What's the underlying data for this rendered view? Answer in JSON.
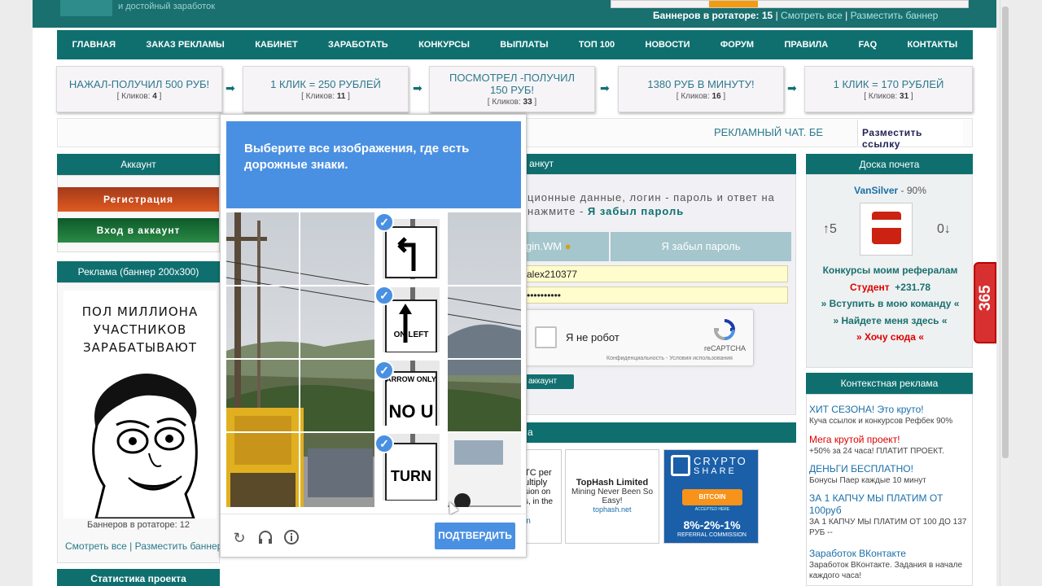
{
  "header": {
    "logo_sub": "и достойный заработок",
    "rotator_prefix": "Баннеров в ротаторе:",
    "rotator_count": "15",
    "sep1": "|",
    "view_all": "Смотреть все",
    "sep2": "|",
    "place_banner": "Разместить баннер"
  },
  "nav": [
    "ГЛАВНАЯ",
    "ЗАКАЗ РЕКЛАМЫ",
    "КАБИНЕТ",
    "ЗАРАБОТАТЬ",
    "КОНКУРСЫ",
    "ВЫПЛАТЫ",
    "ТОП 100",
    "НОВОСТИ",
    "ФОРУМ",
    "ПРАВИЛА",
    "FAQ",
    "КОНТАКТЫ"
  ],
  "promos": [
    {
      "title": "НАЖАЛ-ПОЛУЧИЛ 500 РУБ!",
      "clicks_label": "[ Кликов:",
      "clicks": "4",
      "close": "]"
    },
    {
      "title": "1 КЛИК = 250 РУБЛЕЙ",
      "clicks_label": "[ Кликов:",
      "clicks": "11",
      "close": "]"
    },
    {
      "title": "ПОСМОТРЕЛ -ПОЛУЧИЛ 150 РУБ!",
      "clicks_label": "[ Кликов:",
      "clicks": "33",
      "close": "]"
    },
    {
      "title": "1380 РУБ В МИНУТУ!",
      "clicks_label": "[ Кликов:",
      "clicks": "16",
      "close": "]"
    },
    {
      "title": "1 КЛИК = 170 РУБЛЕЙ",
      "clicks_label": "[ Кликов:",
      "clicks": "31",
      "close": "]"
    }
  ],
  "row2": {
    "chat": "РЕКЛАМНЫЙ ЧАТ. БЕ",
    "place_link": "Разместить ссылку"
  },
  "account": {
    "title": "Аккаунт",
    "register": "Регистрация",
    "login": "Вход в аккаунт"
  },
  "ad": {
    "title": "Реклама (баннер 200x300)",
    "text": [
      "ПОЛ МИЛЛИОНА",
      "УЧАСТНИКОВ",
      "ЗАРАБАТЫВАЮТ"
    ],
    "rotator": "Баннеров в ротаторе: 12",
    "view_all": "Смотреть все",
    "sep": "|",
    "place": "Разместить баннер"
  },
  "stats": {
    "title": "Статистика проекта"
  },
  "center": {
    "head": "анкут",
    "text1": "ционные данные, логин - пароль и ответ на",
    "text2_a": "нажмите -",
    "text2_b": "Я забыл пароль",
    "tab_wm": "gin.WM",
    "tab_forgot": "Я забыл пароль",
    "login_value": "alex210377",
    "password_value": "••••••••••",
    "recaptcha_label": "Я не робот",
    "recaptcha_name": "reCAPTCHA",
    "recaptcha_sub": "Конфиденциальность - Условия использования",
    "enter_btn": "аккаунт",
    "lower_head": "а"
  },
  "minibanners": {
    "left_lines": [
      "TC per",
      "ultiply",
      "sion on",
      "s, in the",
      "t",
      "in"
    ],
    "tophash_title": "TopHash Limited",
    "tophash_desc": "Mining Never Been So Easy!",
    "tophash_url": "tophash.net",
    "crypto_line1": "CRYPTO",
    "crypto_line2": "SHARE",
    "crypto_bitcoin": "BITCOIN",
    "crypto_accepted": "ACCEPTED HERE",
    "crypto_rates": "8%-2%-1%",
    "crypto_referral": "REFERRAL COMMISSION"
  },
  "honor": {
    "title": "Доска почета",
    "user": "VanSilver",
    "percent": "- 90%",
    "up": "↑5",
    "down": "0↓",
    "contests": "Конкурсы моим рефералам",
    "student": "Студент",
    "amount": "+231.78",
    "join": "» Вступить в мою команду «",
    "find": "» Найдете меня здесь «",
    "want": "» Хочу сюда «"
  },
  "context": {
    "title": "Контекстная реклама",
    "items": [
      {
        "t": "ХИТ СЕЗОНА! Это круто!",
        "d": "Куча ссылок и конкурсов Рефбек 90%",
        "red": false
      },
      {
        "t": "Мега крутой проект!",
        "d": "+50% за 24 часа! ПЛАТИТ ПРОЕКТ.",
        "red": true
      },
      {
        "t": "ДЕНЬГИ БЕСПЛАТНО!",
        "d": "Бонусы Паер каждые 10 минут",
        "red": false
      },
      {
        "t": "ЗА 1 КАПЧУ МЫ ПЛАТИМ ОТ 100руб",
        "d": "ЗА 1 КАПЧУ МЫ ПЛАТИМ ОТ 100 ДО 137 РУБ --",
        "red": false
      },
      {
        "t": "Заработок ВКонтакте",
        "d": "Заработок ВКонтакте. Задания в начале каждого часа!",
        "red": false
      }
    ]
  },
  "tab365": "365",
  "captcha": {
    "instruction": "Выберите все изображения, где есть",
    "target": "дорожные знаки.",
    "verify": "ПОДТВЕРДИТЬ",
    "sign_texts": [
      "ON LEFT",
      "NO U",
      "TURN",
      "ARROW ONLY"
    ]
  },
  "colors": {
    "teal": "#0f6f6f",
    "captcha_blue": "#4a90e2",
    "link": "#2a7a8a"
  }
}
